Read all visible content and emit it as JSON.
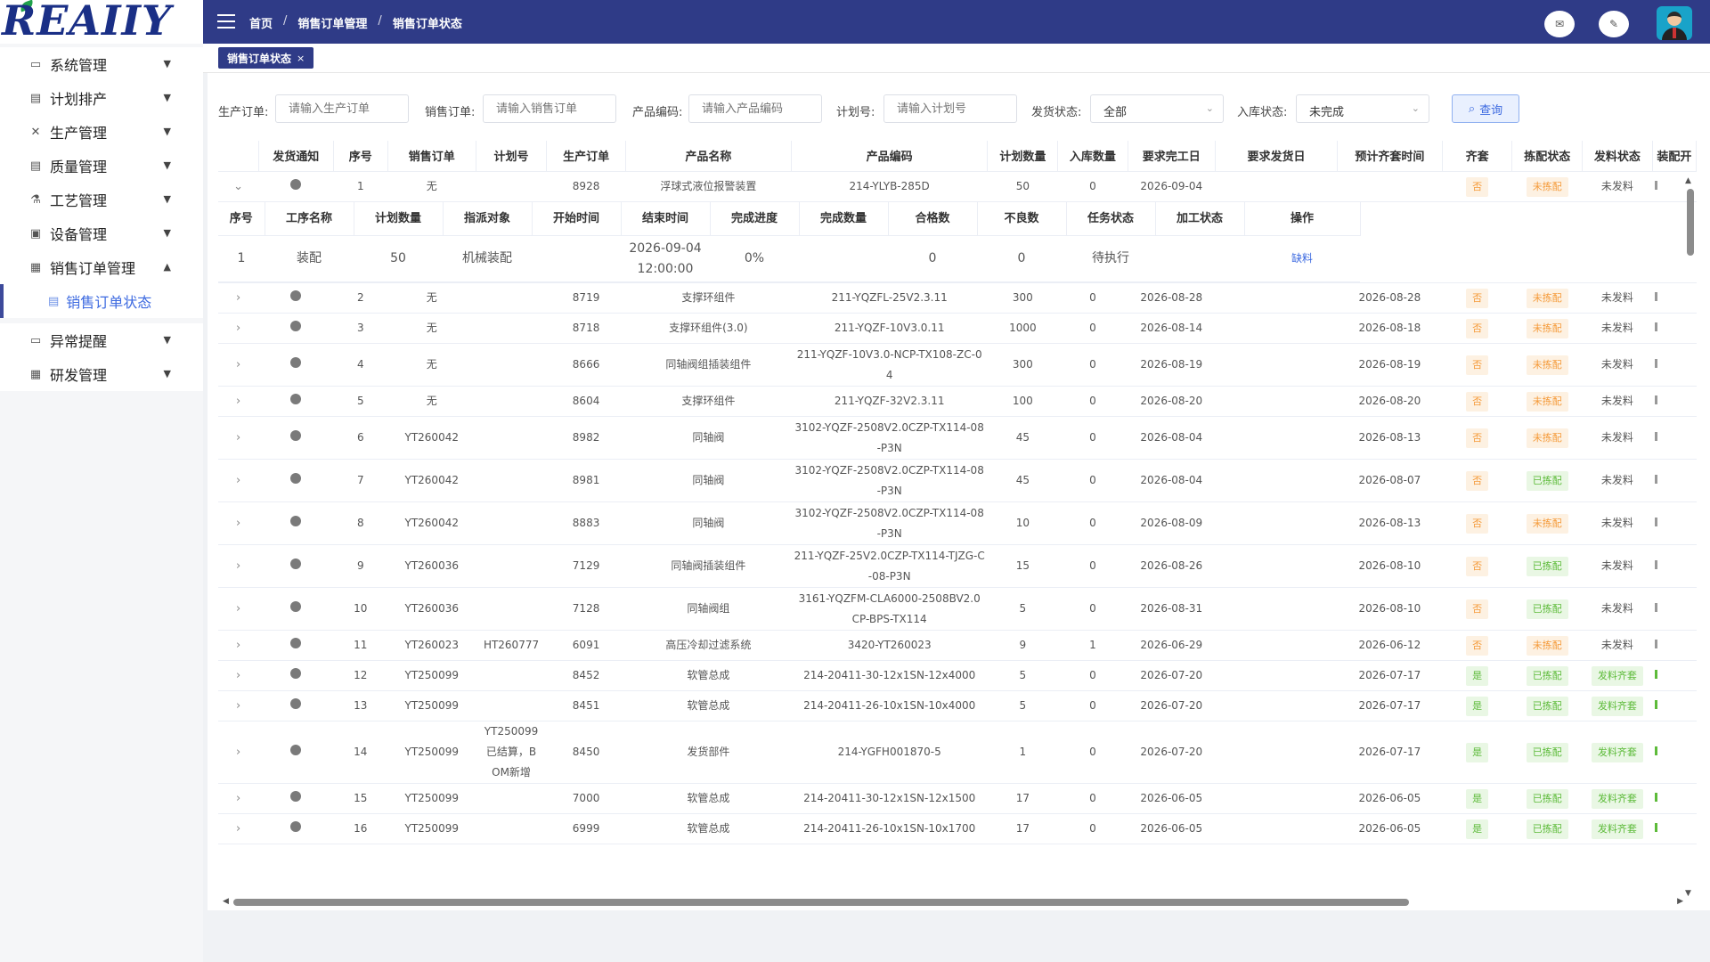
{
  "app": {
    "logo": "REAIIY"
  },
  "sidebar": {
    "items": [
      {
        "label": "系统管理",
        "icon": "monitor-icon",
        "arrow": "▼"
      },
      {
        "label": "计划排产",
        "icon": "clipboard-icon",
        "arrow": "▼"
      },
      {
        "label": "生产管理",
        "icon": "tools-icon",
        "arrow": "▼"
      },
      {
        "label": "质量管理",
        "icon": "document-icon",
        "arrow": "▼"
      },
      {
        "label": "工艺管理",
        "icon": "flask-icon",
        "arrow": "▼"
      },
      {
        "label": "设备管理",
        "icon": "device-icon",
        "arrow": "▼"
      },
      {
        "label": "销售订单管理",
        "icon": "order-icon",
        "arrow": "▲"
      }
    ],
    "sub_item": {
      "label": "销售订单状态",
      "icon": "list-icon"
    },
    "items_after": [
      {
        "label": "异常提醒",
        "icon": "monitor-icon",
        "arrow": "▼"
      },
      {
        "label": "研发管理",
        "icon": "calendar-icon",
        "arrow": "▼"
      }
    ]
  },
  "header": {
    "breadcrumb": [
      "首页",
      "销售订单管理",
      "销售订单状态"
    ],
    "sep": "/",
    "icons": {
      "message": "✉",
      "edit": "✎"
    }
  },
  "tabs": [
    {
      "label": "销售订单状态",
      "close": "×"
    }
  ],
  "filters": {
    "production_order": {
      "label": "生产订单:",
      "placeholder": "请输入生产订单"
    },
    "sales_order": {
      "label": "销售订单:",
      "placeholder": "请输入销售订单"
    },
    "product_code": {
      "label": "产品编码:",
      "placeholder": "请输入产品编码"
    },
    "plan_no": {
      "label": "计划号:",
      "placeholder": "请输入计划号"
    },
    "ship_status": {
      "label": "发货状态:",
      "value": "全部"
    },
    "stock_status": {
      "label": "入库状态:",
      "value": "未完成"
    },
    "search_button": "查询",
    "search_icon": "⌕",
    "chevron": "⌄"
  },
  "table": {
    "headers": [
      "",
      "发货通知",
      "序号",
      "销售订单",
      "计划号",
      "生产订单",
      "产品名称",
      "产品编码",
      "计划数量",
      "入库数量",
      "要求完工日",
      "要求发货日",
      "预计齐套时间",
      "齐套",
      "拣配状态",
      "发料状态",
      "装配开"
    ],
    "expanded_row_index": 0,
    "rows": [
      {
        "seq": "1",
        "sales": "无",
        "plan": "",
        "prod": "8928",
        "name": "浮球式液位报警装置",
        "code": "214-YLYB-285D",
        "qty": "50",
        "stock": "0",
        "finish": "2026-09-04",
        "ship": "",
        "eta": "",
        "kit": "否",
        "pick": "未拣配",
        "issue": "未发料"
      },
      {
        "seq": "2",
        "sales": "无",
        "plan": "",
        "prod": "8719",
        "name": "支撑环组件",
        "code": "211-YQZFL-25V2.3.11",
        "qty": "300",
        "stock": "0",
        "finish": "2026-08-28",
        "ship": "",
        "eta": "2026-08-28",
        "kit": "否",
        "pick": "未拣配",
        "issue": "未发料"
      },
      {
        "seq": "3",
        "sales": "无",
        "plan": "",
        "prod": "8718",
        "name": "支撑环组件(3.0)",
        "code": "211-YQZF-10V3.0.11",
        "qty": "1000",
        "stock": "0",
        "finish": "2026-08-14",
        "ship": "",
        "eta": "2026-08-18",
        "kit": "否",
        "pick": "未拣配",
        "issue": "未发料"
      },
      {
        "seq": "4",
        "sales": "无",
        "plan": "",
        "prod": "8666",
        "name": "同轴阀组插装组件",
        "code": "211-YQZF-10V3.0-NCP-TX108-ZC-04",
        "code_lines": [
          "211-YQZF-10V3.0-NCP-TX108-ZC-0",
          "4"
        ],
        "qty": "300",
        "stock": "0",
        "finish": "2026-08-19",
        "ship": "",
        "eta": "2026-08-19",
        "kit": "否",
        "pick": "未拣配",
        "issue": "未发料"
      },
      {
        "seq": "5",
        "sales": "无",
        "plan": "",
        "prod": "8604",
        "name": "支撑环组件",
        "code": "211-YQZF-32V2.3.11",
        "qty": "100",
        "stock": "0",
        "finish": "2026-08-20",
        "ship": "",
        "eta": "2026-08-20",
        "kit": "否",
        "pick": "未拣配",
        "issue": "未发料"
      },
      {
        "seq": "6",
        "sales": "YT260042",
        "plan": "",
        "prod": "8982",
        "name": "同轴阀",
        "code": "3102-YQZF-2508V2.0CZP-TX114-08-P3N",
        "code_lines": [
          "3102-YQZF-2508V2.0CZP-TX114-08",
          "-P3N"
        ],
        "qty": "45",
        "stock": "0",
        "finish": "2026-08-04",
        "ship": "",
        "eta": "2026-08-13",
        "kit": "否",
        "pick": "未拣配",
        "issue": "未发料"
      },
      {
        "seq": "7",
        "sales": "YT260042",
        "plan": "",
        "prod": "8981",
        "name": "同轴阀",
        "code": "3102-YQZF-2508V2.0CZP-TX114-08-P3N",
        "code_lines": [
          "3102-YQZF-2508V2.0CZP-TX114-08",
          "-P3N"
        ],
        "qty": "45",
        "stock": "0",
        "finish": "2026-08-04",
        "ship": "",
        "eta": "2026-08-07",
        "kit": "否",
        "pick": "已拣配",
        "issue": "未发料"
      },
      {
        "seq": "8",
        "sales": "YT260042",
        "plan": "",
        "prod": "8883",
        "name": "同轴阀",
        "code": "3102-YQZF-2508V2.0CZP-TX114-08-P3N",
        "code_lines": [
          "3102-YQZF-2508V2.0CZP-TX114-08",
          "-P3N"
        ],
        "qty": "10",
        "stock": "0",
        "finish": "2026-08-09",
        "ship": "",
        "eta": "2026-08-13",
        "kit": "否",
        "pick": "未拣配",
        "issue": "未发料"
      },
      {
        "seq": "9",
        "sales": "YT260036",
        "plan": "",
        "prod": "7129",
        "name": "同轴阀插装组件",
        "code": "211-YQZF-25V2.0CZP-TX114-TJZG-C-08-P3N",
        "code_lines": [
          "211-YQZF-25V2.0CZP-TX114-TJZG-C",
          "-08-P3N"
        ],
        "qty": "15",
        "stock": "0",
        "finish": "2026-08-26",
        "ship": "",
        "eta": "2026-08-10",
        "kit": "否",
        "pick": "已拣配",
        "issue": "未发料"
      },
      {
        "seq": "10",
        "sales": "YT260036",
        "plan": "",
        "prod": "7128",
        "name": "同轴阀组",
        "code": "3161-YQZFM-CLA6000-2508BV2.0CP-BPS-TX114",
        "code_lines": [
          "3161-YQZFM-CLA6000-2508BV2.0",
          "CP-BPS-TX114"
        ],
        "qty": "5",
        "stock": "0",
        "finish": "2026-08-31",
        "ship": "",
        "eta": "2026-08-10",
        "kit": "否",
        "pick": "已拣配",
        "issue": "未发料"
      },
      {
        "seq": "11",
        "sales": "YT260023",
        "plan": "HT260777",
        "prod": "6091",
        "name": "高压冷却过滤系统",
        "code": "3420-YT260023",
        "qty": "9",
        "stock": "1",
        "finish": "2026-06-29",
        "ship": "",
        "eta": "2026-06-12",
        "kit": "否",
        "pick": "未拣配",
        "issue": "未发料"
      },
      {
        "seq": "12",
        "sales": "YT250099",
        "plan": "",
        "prod": "8452",
        "name": "软管总成",
        "code": "214-20411-30-12x1SN-12x4000",
        "qty": "5",
        "stock": "0",
        "finish": "2026-07-20",
        "ship": "",
        "eta": "2026-07-17",
        "kit": "是",
        "pick": "已拣配",
        "issue": "发料齐套"
      },
      {
        "seq": "13",
        "sales": "YT250099",
        "plan": "",
        "prod": "8451",
        "name": "软管总成",
        "code": "214-20411-26-10x1SN-10x4000",
        "qty": "5",
        "stock": "0",
        "finish": "2026-07-20",
        "ship": "",
        "eta": "2026-07-17",
        "kit": "是",
        "pick": "已拣配",
        "issue": "发料齐套"
      },
      {
        "seq": "14",
        "sales": "YT250099",
        "plan": "YT250099已结算，BOM新增",
        "plan_lines": [
          "YT250099",
          "已结算，B",
          "OM新增"
        ],
        "prod": "8450",
        "name": "发货部件",
        "code": "214-YGFH001870-5",
        "qty": "1",
        "stock": "0",
        "finish": "2026-07-20",
        "ship": "",
        "eta": "2026-07-17",
        "kit": "是",
        "pick": "已拣配",
        "issue": "发料齐套"
      },
      {
        "seq": "15",
        "sales": "YT250099",
        "plan": "",
        "prod": "7000",
        "name": "软管总成",
        "code": "214-20411-30-12x1SN-12x1500",
        "qty": "17",
        "stock": "0",
        "finish": "2026-06-05",
        "ship": "",
        "eta": "2026-06-05",
        "kit": "是",
        "pick": "已拣配",
        "issue": "发料齐套"
      },
      {
        "seq": "16",
        "sales": "YT250099",
        "plan": "",
        "prod": "6999",
        "name": "软管总成",
        "code": "214-20411-26-10x1SN-10x1700",
        "qty": "17",
        "stock": "0",
        "finish": "2026-06-05",
        "ship": "",
        "eta": "2026-06-05",
        "kit": "是",
        "pick": "已拣配",
        "issue": "发料齐套"
      }
    ]
  },
  "subtable": {
    "headers": [
      "序号",
      "工序名称",
      "计划数量",
      "指派对象",
      "开始时间",
      "结束时间",
      "完成进度",
      "完成数量",
      "合格数",
      "不良数",
      "任务状态",
      "加工状态",
      "操作"
    ],
    "rows": [
      {
        "seq": "1",
        "process": "装配",
        "qty": "50",
        "assignee": "机械装配",
        "start": "",
        "end_lines": [
          "2026-09-04",
          "12:00:00"
        ],
        "progress": "0%",
        "done": "",
        "pass": "0",
        "bad": "0",
        "task": "待执行",
        "work": "",
        "action": "缺料"
      }
    ]
  },
  "colors": {
    "header_bg": "#2f3b87",
    "accent": "#3d6ae0",
    "orange": "#f59b3a",
    "green": "#5dbb3a"
  }
}
